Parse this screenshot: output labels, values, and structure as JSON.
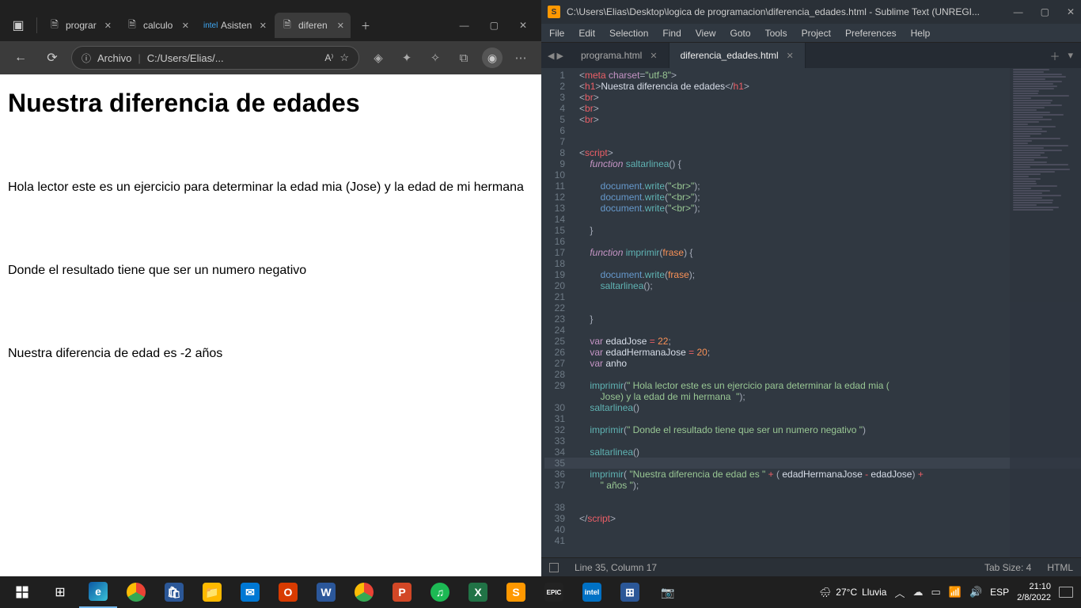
{
  "browser": {
    "tabs": [
      {
        "icon": "🗎",
        "label": "prograr"
      },
      {
        "icon": "🗎",
        "label": "calculo"
      },
      {
        "icon": "in",
        "label": "Asisten"
      },
      {
        "icon": "🗎",
        "label": "diferen"
      }
    ],
    "active_tab_index": 3,
    "addressbar": {
      "info_label": "Archivo",
      "path": "C:/Users/Elias/..."
    },
    "page": {
      "heading": "Nuestra diferencia de edades",
      "para1": "Hola lector este es un ejercicio para determinar la edad mia (Jose) y la edad de mi hermana",
      "para2": "Donde el resultado tiene que ser un numero negativo",
      "para3": "Nuestra diferencia de edad es -2 años"
    },
    "win_buttons": {
      "min": "—",
      "max": "▢",
      "close": "✕"
    }
  },
  "editor": {
    "title_path": "C:\\Users\\Elias\\Desktop\\logica de programacion\\diferencia_edades.html - Sublime Text (UNREGI...",
    "menu": [
      "File",
      "Edit",
      "Selection",
      "Find",
      "View",
      "Goto",
      "Tools",
      "Project",
      "Preferences",
      "Help"
    ],
    "tabs": [
      {
        "label": "programa.html",
        "active": false
      },
      {
        "label": "diferencia_edades.html",
        "active": true
      }
    ],
    "status": {
      "cursor": "Line 35, Column 17",
      "tab_size": "Tab Size: 4",
      "syntax": "HTML"
    },
    "win_buttons": {
      "min": "—",
      "max": "▢",
      "close": "✕"
    },
    "code_vars": {
      "edadJose": 22,
      "edadHermanaJose": 20
    }
  },
  "taskbar": {
    "weather": {
      "temp": "27°C",
      "cond": "Lluvia"
    },
    "lang": "ESP",
    "time": "21:10",
    "date": "2/8/2022"
  }
}
